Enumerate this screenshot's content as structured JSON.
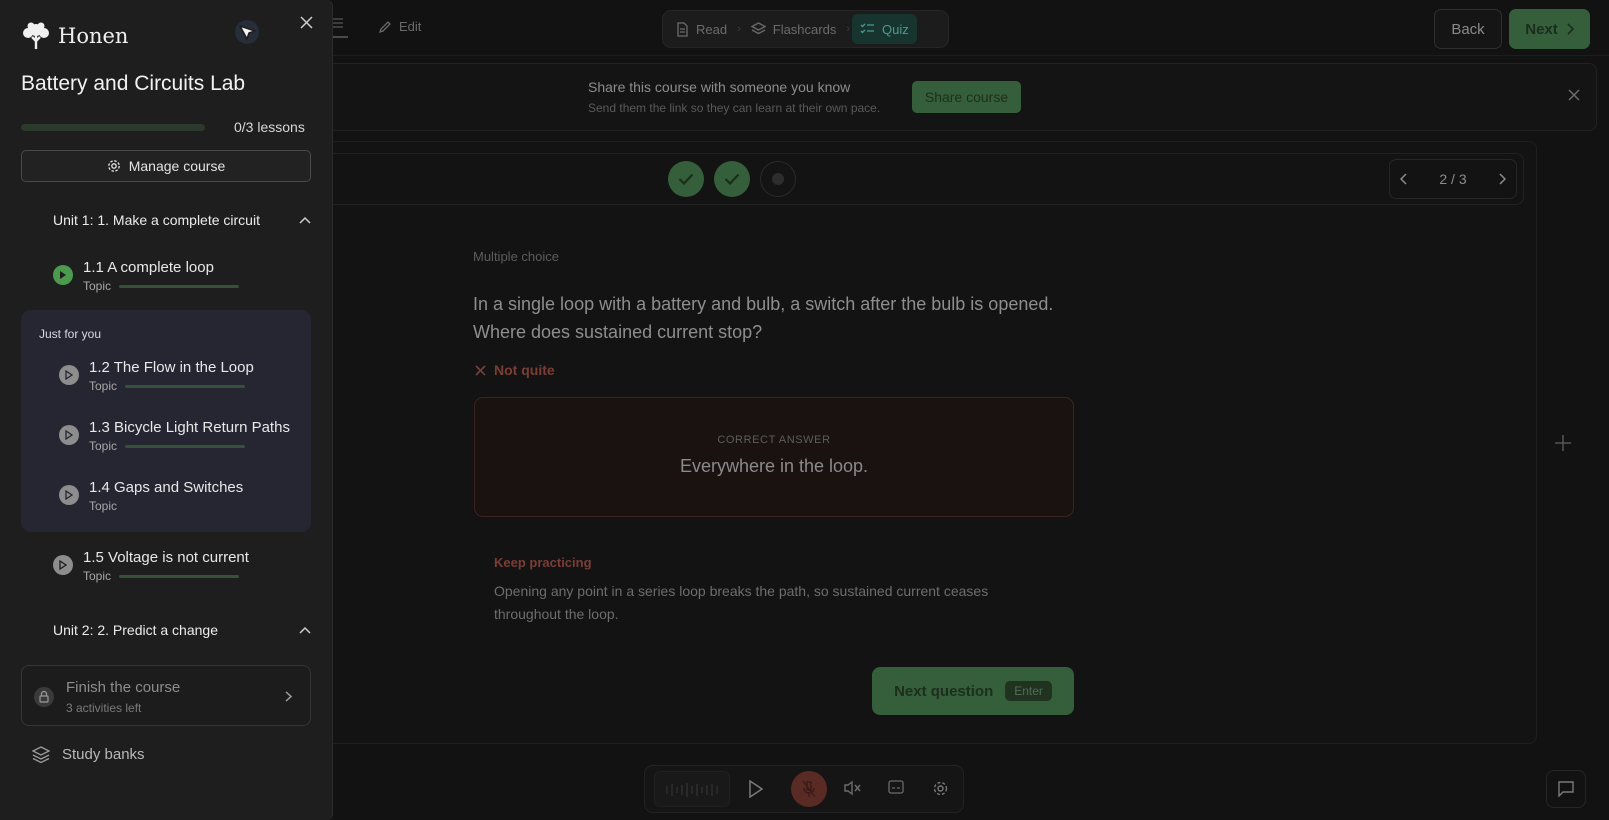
{
  "topbar": {
    "edit_label": "Edit",
    "modes": [
      {
        "label": "Read",
        "icon": "document-icon"
      },
      {
        "label": "Flashcards",
        "icon": "layers-icon"
      },
      {
        "label": "Quiz",
        "icon": "checklist-icon",
        "active": true
      }
    ],
    "back_label": "Back",
    "next_label": "Next"
  },
  "banner": {
    "title": "Share this course with someone you know",
    "subtitle": "Send them the link so they can learn at their own pace.",
    "button": "Share course"
  },
  "quiz": {
    "steps": [
      "done",
      "done",
      "current"
    ],
    "pager": "2 / 3",
    "type": "Multiple choice",
    "question": "In a single loop with a battery and bulb, a switch after the bulb is opened. Where does sustained current stop?",
    "verdict": "Not quite",
    "correct_label": "CORRECT ANSWER",
    "correct_answer": "Everywhere in the loop.",
    "feedback_title": "Keep practicing",
    "feedback_text": "Opening any point in a series loop breaks the path, so sustained current ceases throughout the loop.",
    "next_button": "Next question",
    "next_key": "Enter"
  },
  "sidebar": {
    "brand": "Honen",
    "course_title": "Battery and Circuits Lab",
    "progress_text": "0/3 lessons",
    "progress": 0,
    "manage_label": "Manage course",
    "unit1": "Unit 1: 1. Make a complete circuit",
    "unit2": "Unit 2: 2. Predict a change",
    "foryou_label": "Just for you",
    "lessons": [
      {
        "title": "1.1 A complete loop",
        "meta": "Topic"
      },
      {
        "title": "1.2 The Flow in the Loop",
        "meta": "Topic"
      },
      {
        "title": "1.3 Bicycle Light Return Paths",
        "meta": "Topic"
      },
      {
        "title": "1.4 Gaps and Switches",
        "meta": "Topic"
      },
      {
        "title": "1.5 Voltage is not current",
        "meta": "Topic"
      }
    ],
    "finish_title": "Finish the course",
    "finish_sub": "3 activities left",
    "study_banks": "Study banks"
  }
}
